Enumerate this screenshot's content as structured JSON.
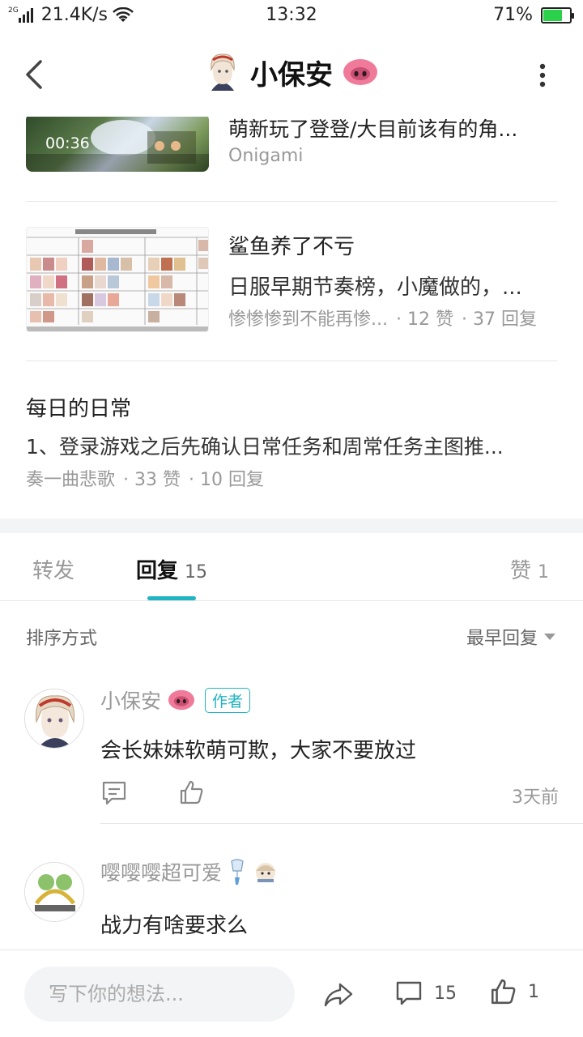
{
  "status_bar": {
    "network": "2G",
    "speed": "21.4K/s",
    "time": "13:32",
    "battery": "71%",
    "battery_level": 0.71
  },
  "header": {
    "title": "小保安"
  },
  "feed": [
    {
      "title": "萌新玩了登登/大目前该有的角...",
      "author": "Onigami",
      "duration": "00:36"
    },
    {
      "title": "鲨鱼养了不亏",
      "excerpt": "日服早期节奏榜，小魔做的，...",
      "author": "惨惨惨到不能再惨...",
      "likes": "· 12 赞",
      "replies": "· 37 回复"
    },
    {
      "title": "每日的日常",
      "excerpt": "1、登录游戏之后先确认日常任务和周常任务主图推...",
      "author": "奏一曲悲歌",
      "likes": "· 33 赞",
      "replies": "· 10 回复"
    }
  ],
  "tabs": {
    "forward": "转发",
    "reply": "回复",
    "reply_count": "15",
    "like": "赞",
    "like_count": "1"
  },
  "sort": {
    "label": "排序方式",
    "value": "最早回复"
  },
  "comments": [
    {
      "name": "小保安",
      "badge": "作者",
      "text": "会长妹妹软萌可欺，大家不要放过",
      "time": "3天前"
    },
    {
      "name": "嘤嘤嘤超可爱",
      "text": "战力有啥要求么"
    }
  ],
  "bottom_bar": {
    "placeholder": "写下你的想法...",
    "comment_count": "15",
    "like_count": "1"
  },
  "colors": {
    "accent": "#1fb3c4",
    "battery_green": "#2bd14b",
    "pig_pink": "#f07a9a"
  }
}
